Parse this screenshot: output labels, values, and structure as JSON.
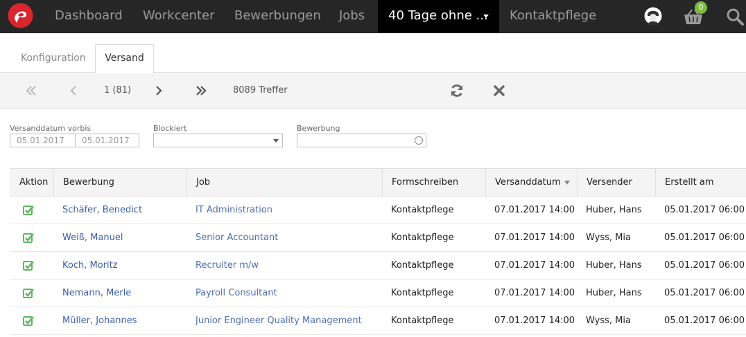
{
  "nav": {
    "items": [
      "Dashboard",
      "Workcenter",
      "Bewerbungen",
      "Jobs"
    ],
    "active": "40 Tage ohne ...",
    "after": "Kontaktpflege",
    "cart_count": "0"
  },
  "tabs": [
    "Konfiguration",
    "Versand"
  ],
  "pager": {
    "page": "1 (81)",
    "hits": "8089 Treffer"
  },
  "filters": {
    "date_label": "Versanddatum vorbis",
    "date_from": "05.01.2017",
    "date_to": "05.01.2017",
    "blocked_label": "Blockiert",
    "blocked_value": "",
    "application_label": "Bewerbung",
    "application_value": ""
  },
  "table": {
    "headers": [
      "Aktion",
      "Bewerbung",
      "Job",
      "Formschreiben",
      "Versanddatum",
      "Versender",
      "Erstellt am"
    ],
    "rows": [
      [
        "Schäfer, Benedict",
        "IT Administration",
        "Kontaktpflege",
        "07.01.2017 14:00",
        "Huber, Hans",
        "05.01.2017 06:00"
      ],
      [
        "Weiß, Manuel",
        "Senior Accountant",
        "Kontaktpflege",
        "07.01.2017 14:00",
        "Wyss, Mia",
        "05.01.2017 06:00"
      ],
      [
        "Koch, Moritz",
        "Recruiter m/w",
        "Kontaktpflege",
        "07.01.2017 14:00",
        "Huber, Hans",
        "05.01.2017 06:00"
      ],
      [
        "Nemann, Merle",
        "Payroll Consultant",
        "Kontaktpflege",
        "07.01.2017 14:00",
        "Huber, Hans",
        "05.01.2017 06:00"
      ],
      [
        "Müller, Johannes",
        "Junior Engineer Quality Management",
        "Kontaktpflege",
        "07.01.2017 14:00",
        "Wyss, Mia",
        "05.01.2017 06:00"
      ]
    ]
  },
  "colors": {
    "nav_bg": "#262626",
    "brand_red": "#d9262e",
    "link": "#3b5ea8",
    "check_green": "#5cb85c"
  }
}
